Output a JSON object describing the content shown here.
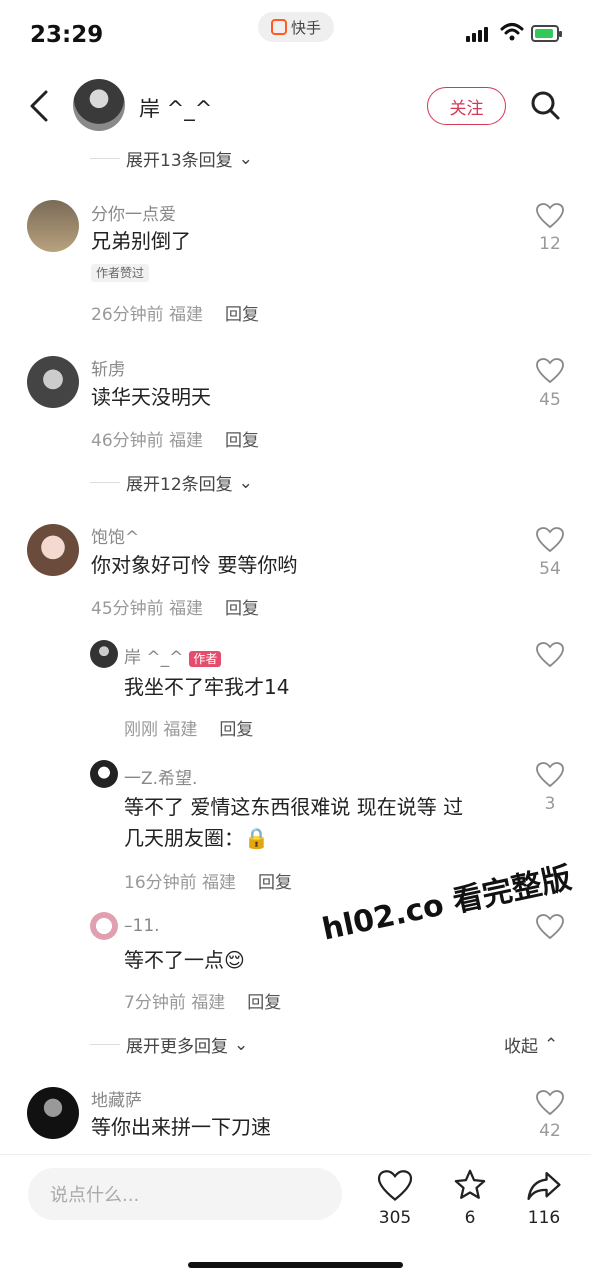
{
  "status": {
    "time": "23:29"
  },
  "app_badge": "快手",
  "header": {
    "title": "岸 ^_^",
    "follow_label": "关注"
  },
  "watermark": "hl02.co 看完整版",
  "comments": [
    {
      "expand_label": "展开13条回复"
    },
    {
      "user": "分你一点爱",
      "text": "兄弟别倒了",
      "badge": "作者赞过",
      "time": "26分钟前",
      "location": "福建",
      "reply": "回复",
      "likes": "12"
    },
    {
      "user": "斩虏",
      "text": "读华天没明天",
      "time": "46分钟前",
      "location": "福建",
      "reply": "回复",
      "likes": "45"
    },
    {
      "expand_label": "展开12条回复"
    },
    {
      "user": "饱饱^",
      "text": "你对象好可怜 要等你哟",
      "time": "45分钟前",
      "location": "福建",
      "reply": "回复",
      "likes": "54"
    },
    {
      "user": "岸 ^_^",
      "author_tag": "作者",
      "text": "我坐不了牢我才14",
      "time": "刚刚",
      "location": "福建",
      "reply": "回复"
    },
    {
      "user": "一Z.希望.",
      "text_line1": "等不了 爱情这东西很难说 现在说等 过",
      "text_line2": "几天朋友圈：🔒",
      "time": "16分钟前",
      "location": "福建",
      "reply": "回复",
      "likes": "3"
    },
    {
      "user": "–11.",
      "text": "等不了一点😌",
      "time": "7分钟前",
      "location": "福建",
      "reply": "回复"
    },
    {
      "expand_label": "展开更多回复",
      "collapse_label": "收起"
    },
    {
      "user": "地藏萨",
      "text": "等你出来拼一下刀速",
      "likes": "42"
    }
  ],
  "bottom": {
    "placeholder": "说点什么...",
    "likes": "305",
    "stars": "6",
    "shares": "116"
  },
  "colors": {
    "accent": "#d33a55",
    "author_tag": "#e44d6c"
  }
}
